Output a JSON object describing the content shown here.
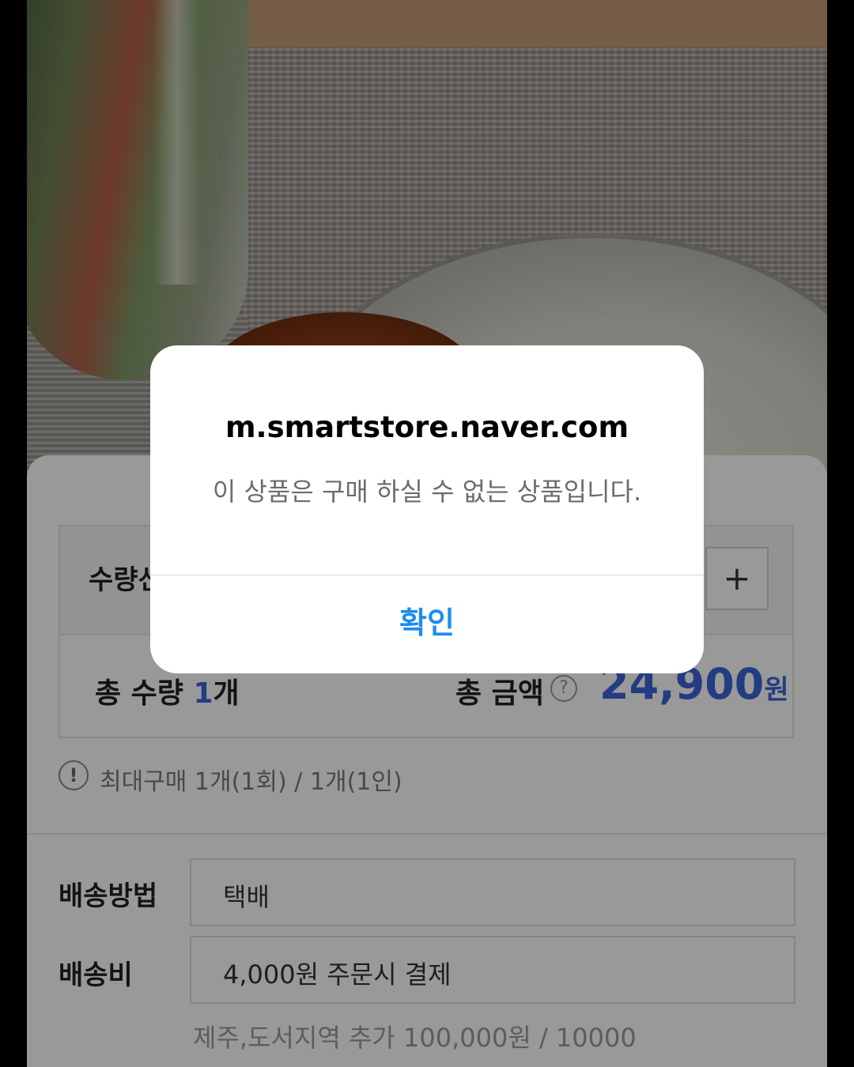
{
  "alert": {
    "title": "m.smartstore.naver.com",
    "message": "이 상품은 구매 하실 수 없는 상품입니다.",
    "confirm_label": "확인"
  },
  "purchase": {
    "quantity_label": "수량선택",
    "stepper_plus": "+",
    "total_qty_prefix": "총 수량 ",
    "total_qty_value": "1",
    "total_qty_unit": "개",
    "total_amount_label": "총 금액",
    "help_icon": "?",
    "total_price": "24,900",
    "currency": "원",
    "limit_icon": "!",
    "limit_text": "최대구매 1개(1회) / 1개(1인)"
  },
  "shipping": {
    "method_label": "배송방법",
    "method_value": "택배",
    "fee_label": "배송비",
    "fee_value": "4,000원 주문시 결제",
    "extra_text": "제주,도서지역 추가 100,000원 / 10000"
  },
  "icons": [
    "plus-icon",
    "help-icon",
    "alert-circle-icon"
  ],
  "colors": {
    "accent_blue": "#1e8cf0",
    "price_blue": "#3c64d8"
  }
}
